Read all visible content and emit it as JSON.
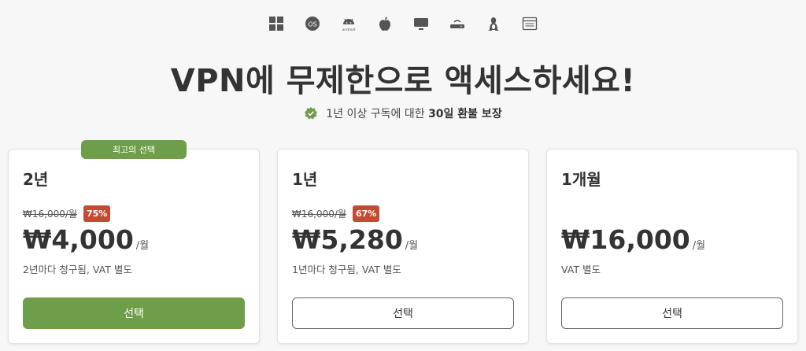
{
  "platforms": [
    {
      "icon": "windows-icon"
    },
    {
      "icon": "macos-icon",
      "label": "OS"
    },
    {
      "icon": "android-icon",
      "label": "android"
    },
    {
      "icon": "apple-icon"
    },
    {
      "icon": "tv-icon"
    },
    {
      "icon": "router-icon"
    },
    {
      "icon": "linux-icon"
    },
    {
      "icon": "browser-icon"
    }
  ],
  "headline": "VPN에 무제한으로 액세스하세요!",
  "guarantee": {
    "prefix": "1년 이상 구독에 대한",
    "highlight": "30일 환불 보장"
  },
  "plans": [
    {
      "badge": "최고의 선택",
      "term": "2년",
      "original_price": "₩16,000/월",
      "discount": "75%",
      "price": "₩4,000",
      "unit": "/월",
      "billing": "2년마다 청구됨, VAT 별도",
      "button": "선택"
    },
    {
      "term": "1년",
      "original_price": "₩16,000/월",
      "discount": "67%",
      "price": "₩5,280",
      "unit": "/월",
      "billing": "1년마다 청구됨, VAT 별도",
      "button": "선택"
    },
    {
      "term": "1개월",
      "price": "₩16,000",
      "unit": "/월",
      "billing": "VAT 별도",
      "button": "선택"
    }
  ],
  "colors": {
    "accent_green": "#6f9e4a",
    "discount_red": "#c44b33",
    "text_dark": "#333333"
  }
}
